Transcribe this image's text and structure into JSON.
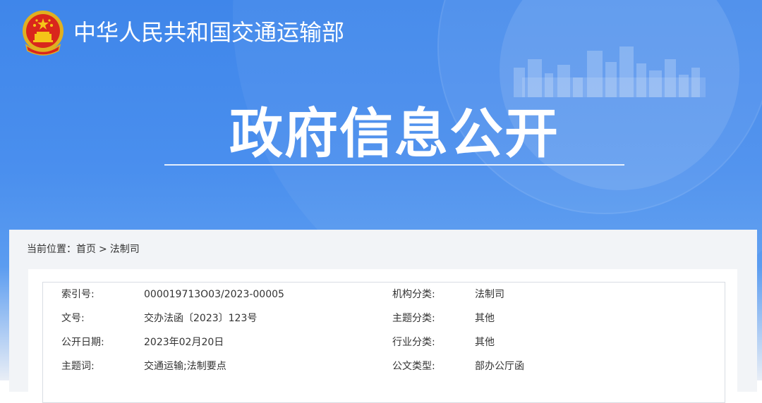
{
  "header": {
    "ministry_name": "中华人民共和国交通运输部",
    "banner_title": "政府信息公开"
  },
  "breadcrumb": {
    "label": "当前位置：",
    "items": [
      "首页",
      "法制司"
    ],
    "separator": ">"
  },
  "info": {
    "rows": [
      {
        "k1": "索引号:",
        "v1": "000019713O03/2023-00005",
        "k2": "机构分类:",
        "v2": "法制司"
      },
      {
        "k1": "文号:",
        "v1": "交办法函〔2023〕123号",
        "k2": "主题分类:",
        "v2": "其他"
      },
      {
        "k1": "公开日期:",
        "v1": "2023年02月20日",
        "k2": "行业分类:",
        "v2": "其他"
      },
      {
        "k1": "主题词:",
        "v1": "交通运输;法制要点",
        "k2": "公文类型:",
        "v2": "部办公厅函"
      }
    ]
  },
  "colors": {
    "banner_blue": "#4a8fee",
    "panel_bg": "#f2f4f7",
    "emblem_red": "#d9261c",
    "emblem_gold": "#f5c518"
  },
  "icons": {
    "emblem": "national-emblem-icon"
  }
}
